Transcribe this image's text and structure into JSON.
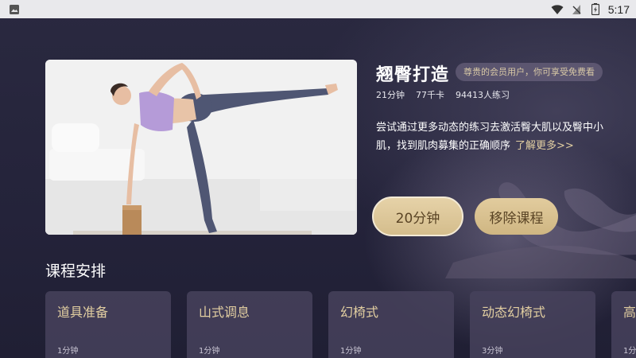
{
  "status_bar": {
    "time": "5:17",
    "icons": [
      "image-icon",
      "wifi-icon",
      "no-sim-icon",
      "battery-charging-icon"
    ]
  },
  "course": {
    "title": "翘臀打造",
    "member_badge": "尊贵的会员用户，你可享受免费看",
    "stats": [
      "21分钟",
      "77千卡",
      "94413人练习"
    ],
    "description": "尝试通过更多动态的练习去激活臀大肌以及臀中小肌，找到肌肉募集的正确顺序",
    "learn_more": "了解更多>>"
  },
  "buttons": {
    "duration": "20分钟",
    "remove": "移除课程"
  },
  "schedule": {
    "title": "课程安排",
    "lessons": [
      {
        "name": "道具准备",
        "duration": "1分钟"
      },
      {
        "name": "山式调息",
        "duration": "1分钟"
      },
      {
        "name": "幻椅式",
        "duration": "1分钟"
      },
      {
        "name": "动态幻椅式",
        "duration": "3分钟"
      },
      {
        "name": "高",
        "duration": "1分钟"
      }
    ]
  },
  "colors": {
    "background": "#23223a",
    "accent_gold": "#e2cfa2",
    "button_gold": "#d9c397"
  }
}
